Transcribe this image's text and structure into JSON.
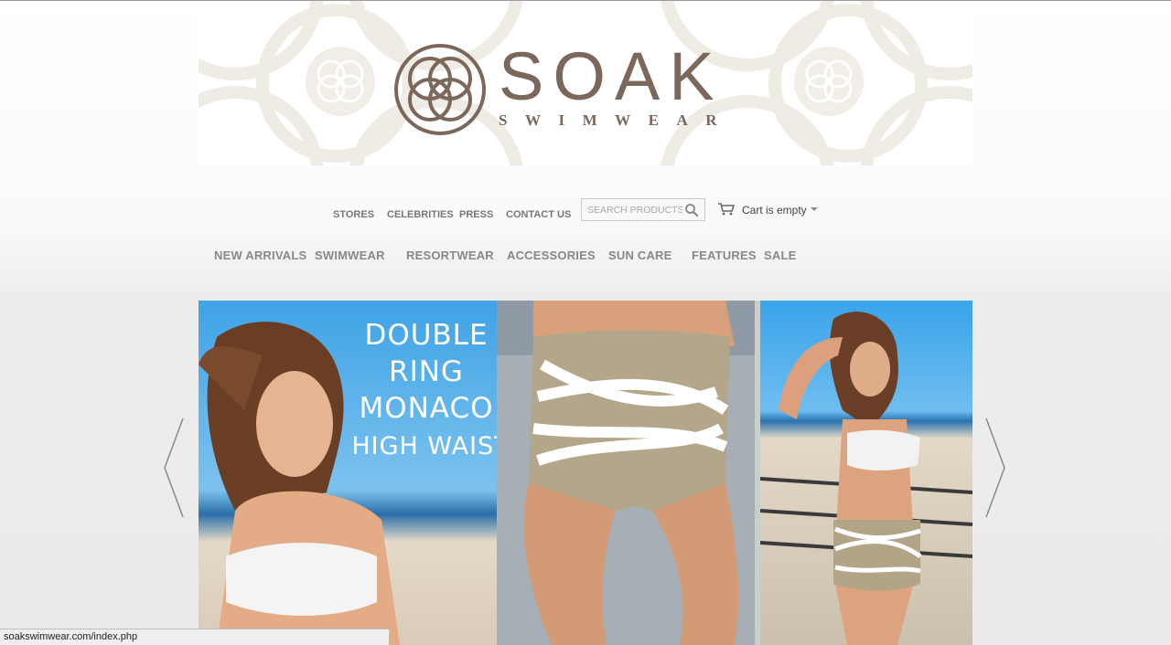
{
  "brand": {
    "name": "SOAK",
    "subtitle": "SWIMWEAR",
    "color": "#7c675b"
  },
  "utility_nav": {
    "items": [
      "STORES",
      "CELEBRITIES",
      "PRESS",
      "CONTACT US"
    ]
  },
  "search": {
    "placeholder": "SEARCH PRODUCTS",
    "value": ""
  },
  "cart": {
    "label": "Cart is empty",
    "icon": "cart-icon"
  },
  "main_nav": {
    "items": [
      "NEW ARRIVALS",
      "SWIMWEAR",
      "RESORTWEAR",
      "ACCESSORIES",
      "SUN CARE",
      "FEATURES",
      "SALE"
    ]
  },
  "slider": {
    "headline": [
      "DOUBLE",
      "RING",
      "MONACO",
      "HIGH WAIST"
    ],
    "prev_icon": "chevron-left-icon",
    "next_icon": "chevron-right-icon",
    "colors": {
      "sky": "#3fa3e6",
      "sand": "#d9cbb8",
      "fabric": "#b4a68a"
    }
  },
  "status_bar": {
    "url": "soakswimwear.com/index.php"
  }
}
